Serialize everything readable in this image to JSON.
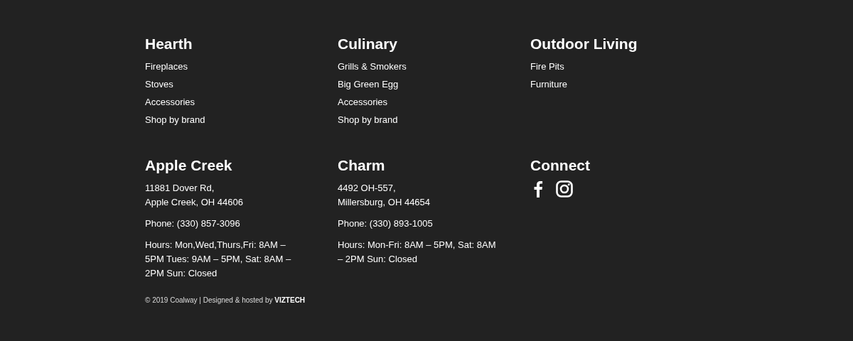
{
  "categories": [
    {
      "title": "Hearth",
      "links": [
        "Fireplaces",
        "Stoves",
        "Accessories",
        "Shop by brand"
      ]
    },
    {
      "title": "Culinary",
      "links": [
        "Grills & Smokers",
        "Big Green Egg",
        "Accessories",
        "Shop by brand"
      ]
    },
    {
      "title": "Outdoor Living",
      "links": [
        "Fire Pits",
        "Furniture"
      ]
    }
  ],
  "locations": [
    {
      "title": "Apple Creek",
      "address_lines": [
        "11881 Dover Rd,",
        "Apple Creek, OH 44606"
      ],
      "phone": "Phone: (330) 857-3096",
      "hours": "Hours: Mon,Wed,Thurs,Fri: 8AM – 5PM Tues: 9AM – 5PM, Sat: 8AM – 2PM Sun: Closed"
    },
    {
      "title": "Charm",
      "address_lines": [
        "4492 OH-557,",
        "Millersburg, OH 44654"
      ],
      "phone": "Phone: (330) 893-1005",
      "hours": "Hours: Mon-Fri: 8AM – 5PM, Sat: 8AM – 2PM Sun: Closed"
    }
  ],
  "connect": {
    "title": "Connect"
  },
  "copyright": "© 2019 Coalway | Designed & hosted by **VIZTECH**"
}
